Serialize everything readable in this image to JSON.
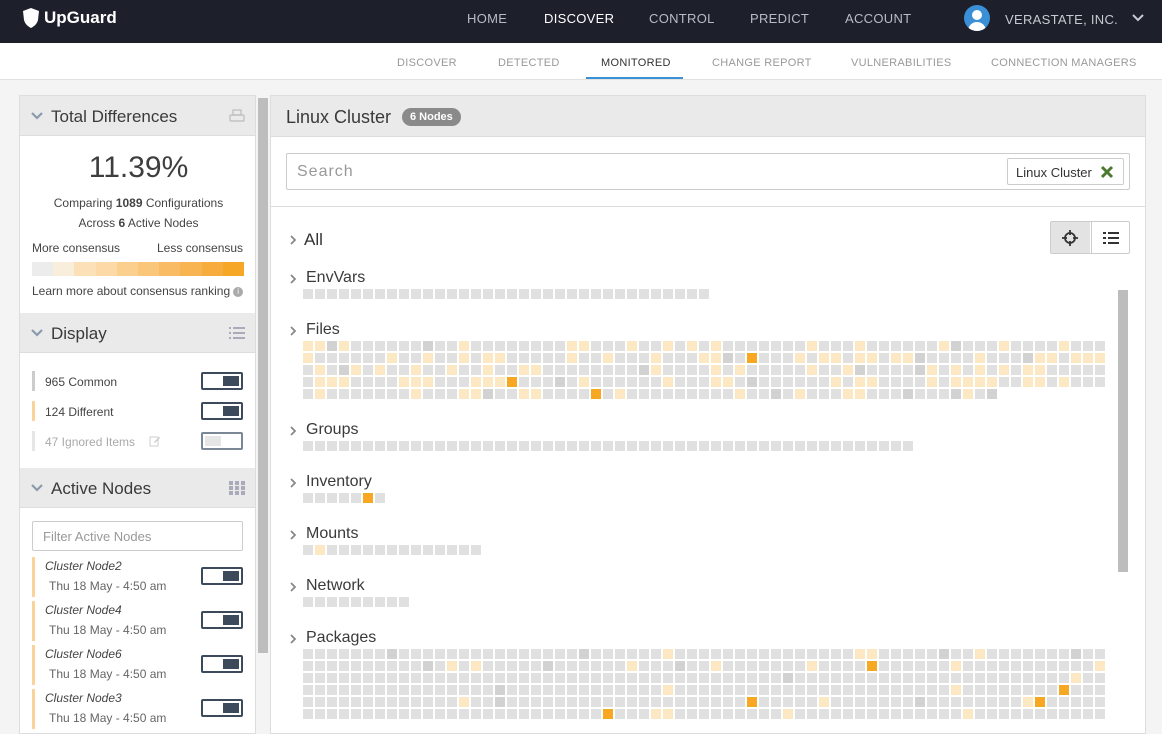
{
  "brand": {
    "name": "UpGuard"
  },
  "topnav": {
    "items": [
      "HOME",
      "DISCOVER",
      "CONTROL",
      "PREDICT",
      "ACCOUNT"
    ],
    "active": "DISCOVER",
    "org": "VERASTATE, INC."
  },
  "subnav": {
    "items": [
      "DISCOVER",
      "DETECTED",
      "MONITORED",
      "CHANGE REPORT",
      "VULNERABILITIES",
      "CONNECTION MANAGERS"
    ],
    "active": "MONITORED"
  },
  "total_differences": {
    "title": "Total Differences",
    "percent": "11.39%",
    "comparing_prefix": "Comparing ",
    "config_count": "1089",
    "comparing_suffix": " Configurations",
    "across_prefix": "Across ",
    "node_count": "6",
    "across_suffix": " Active Nodes",
    "more_label": "More consensus",
    "less_label": "Less consensus",
    "learn_more": "Learn more about consensus ranking",
    "scale_colors": [
      "#ececec",
      "#f9eedc",
      "#fce0b8",
      "#fcd9a6",
      "#fbcf8d",
      "#fac67a",
      "#f9bc64",
      "#f8b451",
      "#f7ad3e",
      "#f7a726"
    ]
  },
  "display": {
    "title": "Display",
    "rows": [
      {
        "label": "965 Common",
        "color": "#cccccc",
        "enabled": true
      },
      {
        "label": "124 Different",
        "color": "#f9d49a",
        "enabled": true
      },
      {
        "label": "47 Ignored Items",
        "color": "#e6e6e6",
        "enabled": false
      }
    ]
  },
  "active_nodes": {
    "title": "Active Nodes",
    "filter_placeholder": "Filter Active Nodes",
    "nodes": [
      {
        "name": "Cluster Node2",
        "time": "Thu 18 May - 4:50 am"
      },
      {
        "name": "Cluster Node4",
        "time": "Thu 18 May - 4:50 am"
      },
      {
        "name": "Cluster Node6",
        "time": "Thu 18 May - 4:50 am"
      },
      {
        "name": "Cluster Node3",
        "time": "Thu 18 May - 4:50 am"
      }
    ]
  },
  "main": {
    "title": "Linux Cluster",
    "badge": "6 Nodes",
    "search_placeholder": "Search",
    "filter_chip": "Linux Cluster",
    "all_label": "All",
    "categories": [
      {
        "name": "EnvVars",
        "count": 34,
        "special": {}
      },
      {
        "name": "Files",
        "count": 326,
        "special": {}
      },
      {
        "name": "Groups",
        "count": 51,
        "special": {}
      },
      {
        "name": "Inventory",
        "count": 7,
        "special": {
          "5": 3
        }
      },
      {
        "name": "Mounts",
        "count": 15,
        "special": {
          "1": 1
        }
      },
      {
        "name": "Network",
        "count": 9,
        "special": {}
      },
      {
        "name": "Packages",
        "count": 402,
        "special": {}
      }
    ]
  }
}
